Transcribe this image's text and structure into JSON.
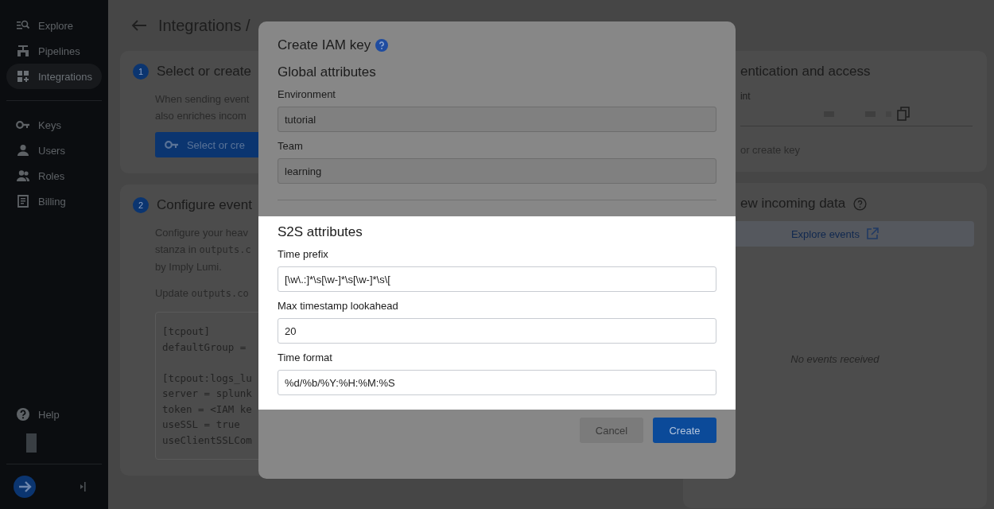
{
  "sidebar": {
    "groups": [
      [
        {
          "label": "Explore",
          "kind": "explore",
          "selected": false
        },
        {
          "label": "Pipelines",
          "kind": "pipelines",
          "selected": false
        },
        {
          "label": "Integrations",
          "kind": "integrations",
          "selected": true
        }
      ],
      [
        {
          "label": "Keys",
          "kind": "keys",
          "selected": false
        },
        {
          "label": "Users",
          "kind": "users",
          "selected": false
        },
        {
          "label": "Roles",
          "kind": "roles",
          "selected": false
        },
        {
          "label": "Billing",
          "kind": "billing",
          "selected": false
        }
      ]
    ],
    "help": "Help"
  },
  "header": {
    "title": "Integrations /"
  },
  "steps": [
    {
      "number": "1",
      "title": "Select or create",
      "lines": [
        {
          "text": "When sending event"
        },
        {
          "text": "also enriches incom"
        }
      ],
      "button": "Select or cre"
    },
    {
      "number": "2",
      "title": "Configure event",
      "lines": [
        {
          "text": "Configure your heav"
        },
        {
          "text": "stanza in ",
          "code": "outputs.c"
        },
        {
          "text": "by Imply Lumi."
        }
      ],
      "update": {
        "text": "Update ",
        "code": "outputs.co"
      },
      "code": [
        [
          "[tcpout]",
          "defaultGroup ="
        ],
        [
          "[tcpout:logs_lu",
          "server = splunk",
          "token = <IAM ke",
          "useSSL = true",
          "useClientSSLCom"
        ]
      ]
    }
  ],
  "auth": {
    "title": "entication and access",
    "endpoint_label": "int",
    "key_hint": "or create key"
  },
  "incoming": {
    "title": "ew incoming data",
    "link": "Explore events",
    "empty": "No events received"
  },
  "modal": {
    "title": "Create IAM key",
    "sections": [
      {
        "title": "Global attributes",
        "highlighted": false,
        "fields": [
          {
            "label": "Environment",
            "value": "tutorial",
            "disabled": true
          },
          {
            "label": "Team",
            "value": "learning",
            "disabled": true
          }
        ]
      },
      {
        "title": "S2S attributes",
        "highlighted": true,
        "fields": [
          {
            "label": "Time prefix",
            "value": "[\\w\\.:]*\\s[\\w-]*\\s[\\w-]*\\s\\[",
            "disabled": false
          },
          {
            "label": "Max timestamp lookahead",
            "value": "20",
            "disabled": false
          },
          {
            "label": "Time format",
            "value": "%d/%b/%Y:%H:%M:%S",
            "disabled": false
          }
        ]
      }
    ],
    "buttons": [
      {
        "label": "Cancel",
        "kind": "secondary"
      },
      {
        "label": "Create",
        "kind": "primary"
      }
    ]
  }
}
